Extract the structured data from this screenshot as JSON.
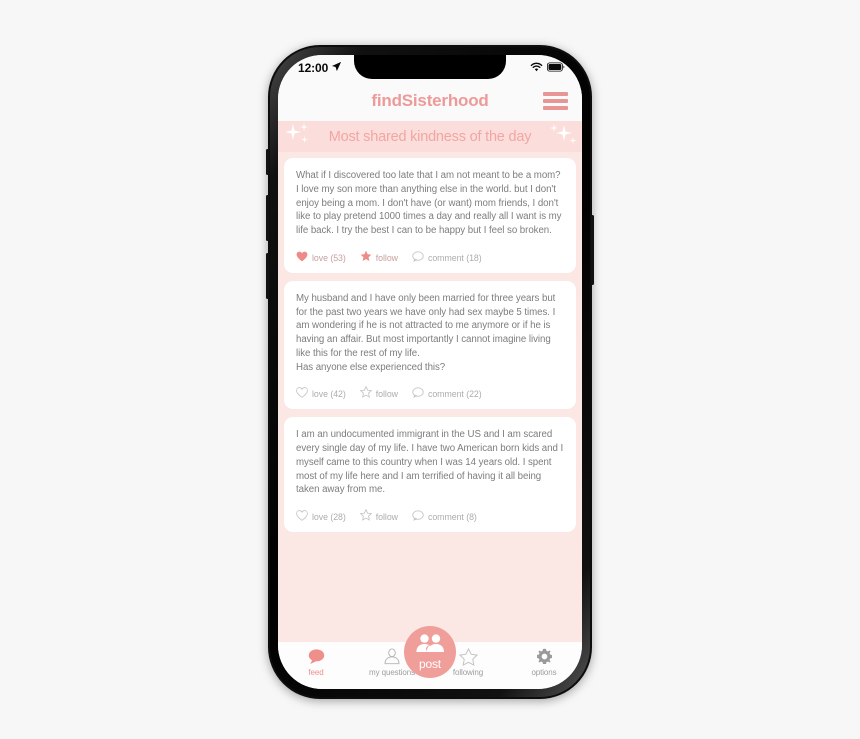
{
  "status_bar": {
    "time": "12:00",
    "location_icon": "location-arrow-icon",
    "wifi_icon": "wifi-icon",
    "battery_icon": "battery-icon"
  },
  "header": {
    "title": "findSisterhood",
    "menu_icon": "hamburger-menu-icon"
  },
  "banner": {
    "title": "Most shared kindness of the day",
    "sparkle_icon": "sparkle-icon"
  },
  "posts": [
    {
      "text": "What if I discovered too late that I am not meant to be a mom?\nI love my son more than anything else in the world.  but I don't enjoy being a mom. I don't have (or want) mom friends, I don't like to play pretend 1000 times a day and really all I want is my life back.  I try the best I can to be happy but I feel so broken.",
      "love_label": "love (53)",
      "follow_label": "follow",
      "comment_label": "comment (18)",
      "love_active": true,
      "follow_active": true
    },
    {
      "text": "My husband and I have only been married for three years but for the past two years we have only had sex maybe 5 times.   I am wondering if he is not attracted to me anymore or if he is having an affair.  But most importantly I cannot imagine living like this for the rest of my life.\nHas anyone else experienced this?",
      "love_label": "love (42)",
      "follow_label": "follow",
      "comment_label": "comment (22)",
      "love_active": false,
      "follow_active": false
    },
    {
      "text": "I am an undocumented immigrant in the US and I am scared every single day of my life. I have two American born kids and I myself came to this country when I was 14 years old. I spent most of my life here and I am terrified of having it all being taken away from me.",
      "love_label": "love (28)",
      "follow_label": "follow",
      "comment_label": "comment (8)",
      "love_active": false,
      "follow_active": false
    }
  ],
  "bottom_nav": {
    "items": [
      {
        "label": "feed",
        "icon": "speech-bubble-icon",
        "active": true
      },
      {
        "label": "my questions",
        "icon": "person-outline-icon",
        "active": false
      },
      {
        "label": "following",
        "icon": "star-outline-icon",
        "active": false
      },
      {
        "label": "options",
        "icon": "gear-icon",
        "active": false
      }
    ],
    "post_button": {
      "label": "post",
      "icon": "two-people-icon"
    }
  },
  "colors": {
    "brand_pink": "#ee9a99",
    "banner_bg": "#fbdedb",
    "feed_bg": "#fbe7e4",
    "card_bg": "#ffffff",
    "post_button": "#f09e9a",
    "text_gray": "#7d7d7d"
  }
}
